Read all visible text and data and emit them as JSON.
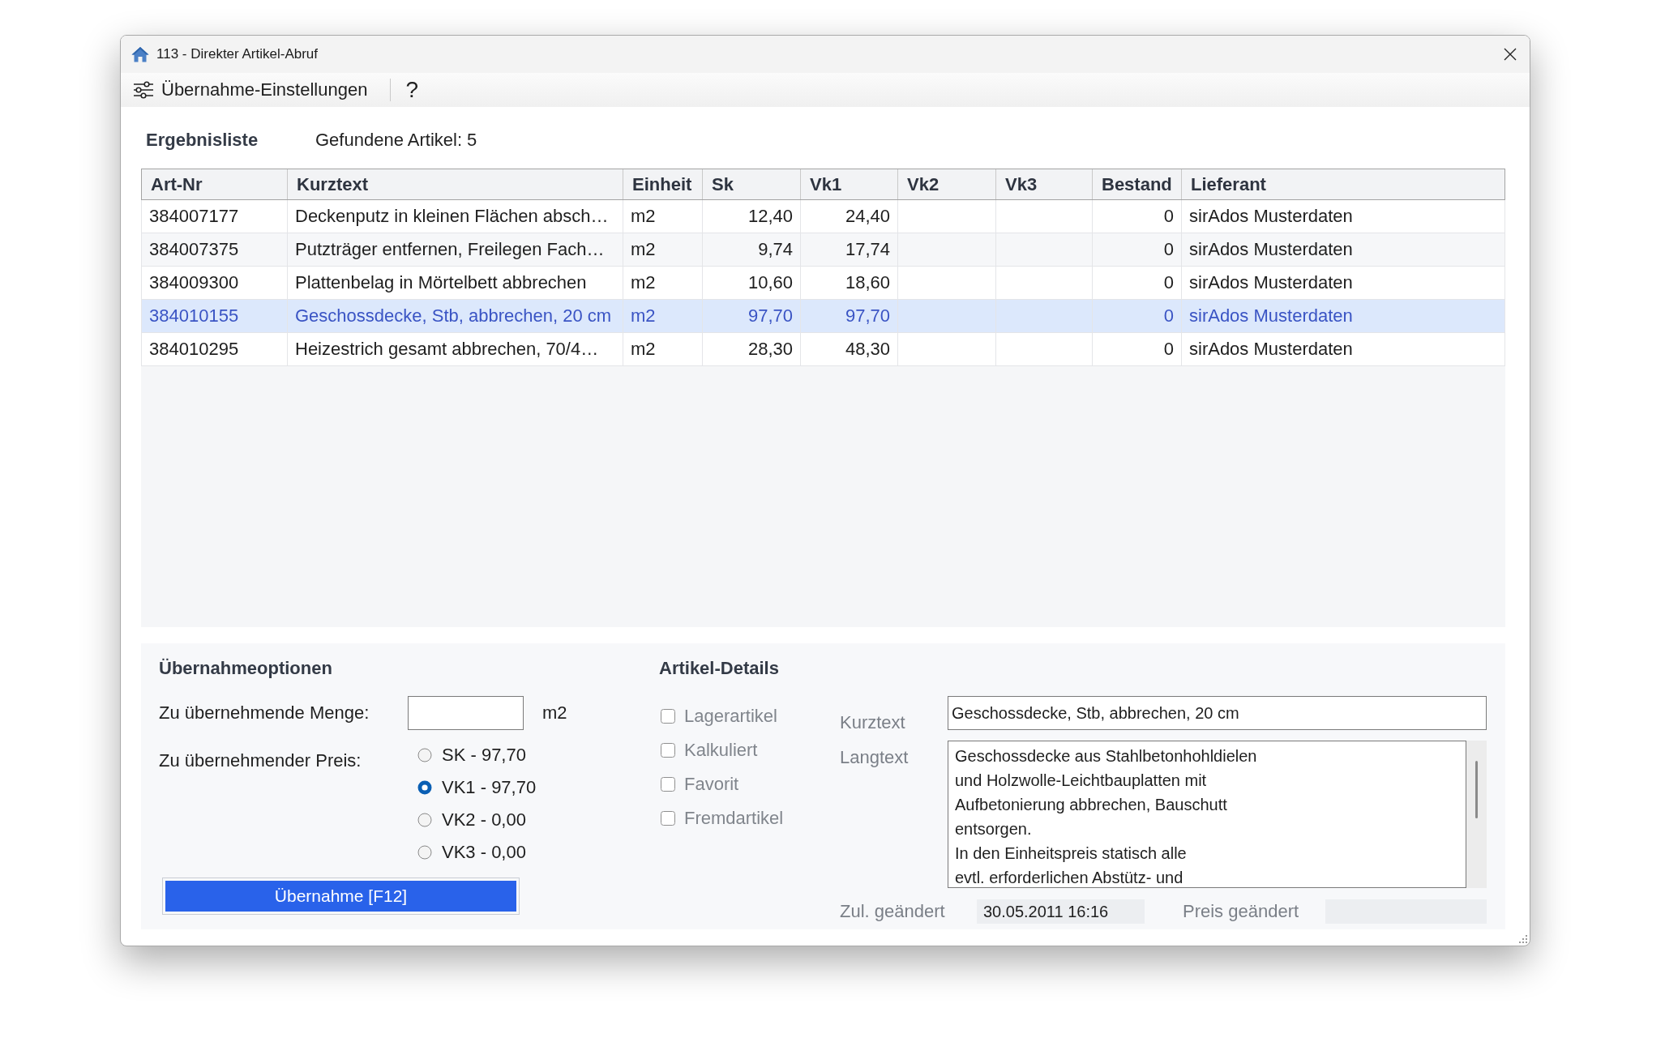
{
  "window": {
    "title": "113 - Direkter Artikel-Abruf"
  },
  "toolbar": {
    "settings_button": "Übernahme-Einstellungen",
    "help_button": "?"
  },
  "results": {
    "heading": "Ergebnisliste",
    "count": "Gefundene Artikel: 5"
  },
  "table": {
    "columns": [
      {
        "label": "Art-Nr",
        "kind": "text"
      },
      {
        "label": "Kurztext",
        "kind": "text"
      },
      {
        "label": "Einheit",
        "kind": "text"
      },
      {
        "label": "Sk",
        "kind": "number"
      },
      {
        "label": "Vk1",
        "kind": "number"
      },
      {
        "label": "Vk2",
        "kind": "number"
      },
      {
        "label": "Vk3",
        "kind": "number"
      },
      {
        "label": "Bestand",
        "kind": "number"
      },
      {
        "label": "Lieferant",
        "kind": "text"
      }
    ],
    "rows": [
      {
        "selected": false,
        "art_nr": "384007177",
        "kurztext": "Deckenputz in kleinen Flächen absch…",
        "einheit": "m2",
        "sk": "12,40",
        "vk1": "24,40",
        "bestand": "0",
        "lieferant": "sirAdos Musterdaten"
      },
      {
        "selected": false,
        "art_nr": "384007375",
        "kurztext": "Putzträger entfernen, Freilegen Fach…",
        "einheit": "m2",
        "sk": "9,74",
        "vk1": "17,74",
        "bestand": "0",
        "lieferant": "sirAdos Musterdaten"
      },
      {
        "selected": false,
        "art_nr": "384009300",
        "kurztext": "Plattenbelag in Mörtelbett abbrechen",
        "einheit": "m2",
        "sk": "10,60",
        "vk1": "18,60",
        "bestand": "0",
        "lieferant": "sirAdos Musterdaten"
      },
      {
        "selected": true,
        "art_nr": "384010155",
        "kurztext": "Geschossdecke, Stb, abbrechen, 20 cm",
        "einheit": "m2",
        "sk": "97,70",
        "vk1": "97,70",
        "bestand": "0",
        "lieferant": "sirAdos Musterdaten"
      },
      {
        "selected": false,
        "art_nr": "384010295",
        "kurztext": "Heizestrich gesamt abbrechen, 70/4…",
        "einheit": "m2",
        "sk": "28,30",
        "vk1": "48,30",
        "bestand": "0",
        "lieferant": "sirAdos Musterdaten"
      }
    ]
  },
  "options": {
    "heading": "Übernahmeoptionen",
    "quantity_label": "Zu übernehmende Menge:",
    "quantity_unit": "m2",
    "price_label": "Zu übernehmender Preis:",
    "price_choices": [
      {
        "label": "SK - 97,70",
        "selected": false
      },
      {
        "label": "VK1 - 97,70",
        "selected": true
      },
      {
        "label": "VK2 - 0,00",
        "selected": false
      },
      {
        "label": "VK3 - 0,00",
        "selected": false
      }
    ],
    "submit_button": "Übernahme [F12]"
  },
  "details": {
    "heading": "Artikel-Details",
    "flags": [
      {
        "label": "Lagerartikel",
        "checked": false,
        "disabled": true
      },
      {
        "label": "Kalkuliert",
        "checked": false,
        "disabled": true
      },
      {
        "label": "Favorit",
        "checked": false,
        "disabled": true
      },
      {
        "label": "Fremdartikel",
        "checked": false,
        "disabled": true
      }
    ],
    "kurztext_label": "Kurztext",
    "kurztext": "Geschossdecke, Stb, abbrechen, 20 cm",
    "langtext_label": "Langtext",
    "langtext": "Geschossdecke aus Stahlbetonhohldielen\nund Holzwolle-Leichtbauplatten mit\nAufbetonierung abbrechen, Bauschutt\nentsorgen.\nIn den Einheitspreis statisch alle\nevtl. erforderlichen Abstütz- und",
    "changed_label": "Zul. geändert",
    "changed": "30.05.2011 16:16",
    "price_changed_label": "Preis geändert"
  }
}
